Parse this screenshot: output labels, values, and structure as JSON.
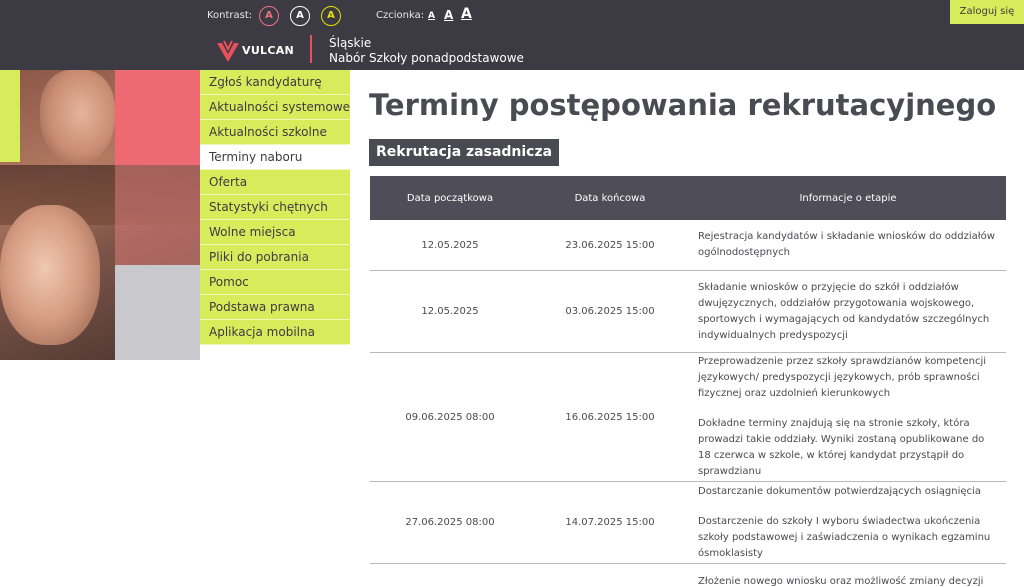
{
  "header": {
    "contrast_label": "Kontrast:",
    "contrast_options": [
      "A",
      "A",
      "A"
    ],
    "font_label": "Czcionka:",
    "font_options": [
      "A",
      "A",
      "A"
    ],
    "login_label": "Zaloguj się",
    "logo_text": "VULCAN",
    "region_line1": "Śląskie",
    "region_line2": "Nabór Szkoły ponadpodstawowe"
  },
  "menu": {
    "items": [
      {
        "label": "Zgłoś kandydaturę"
      },
      {
        "label": "Aktualności systemowe"
      },
      {
        "label": "Aktualności szkolne"
      },
      {
        "label": "Terminy naboru"
      },
      {
        "label": "Oferta"
      },
      {
        "label": "Statystyki chętnych"
      },
      {
        "label": "Wolne miejsca"
      },
      {
        "label": "Pliki do pobrania"
      },
      {
        "label": "Pomoc"
      },
      {
        "label": "Podstawa prawna"
      },
      {
        "label": "Aplikacja mobilna"
      }
    ],
    "active_label": "Terminy naboru"
  },
  "main": {
    "title": "Terminy postępowania rekrutacyjnego",
    "section_title": "Rekrutacja zasadnicza",
    "table": {
      "headers": [
        "Data początkowa",
        "Data końcowa",
        "Informacje o etapie"
      ],
      "rows": [
        {
          "start": "12.05.2025",
          "end": "23.06.2025 15:00",
          "info": [
            "Rejestracja kandydatów i składanie wniosków do oddziałów ogólnodostępnych"
          ]
        },
        {
          "start": "12.05.2025",
          "end": "03.06.2025 15:00",
          "info": [
            "Składanie wniosków o przyjęcie do szkół i oddziałów dwujęzycznych, oddziałów przygotowania wojskowego, sportowych i wymagających od kandydatów szczególnych indywidualnych predyspozycji"
          ]
        },
        {
          "start": "09.06.2025 08:00",
          "end": "16.06.2025 15:00",
          "info": [
            "Przeprowadzenie przez szkoły sprawdzianów kompetencji językowych/ predyspozycji językowych, prób sprawności fizycznej oraz uzdolnień kierunkowych",
            "Dokładne terminy znajdują się na stronie szkoły, która prowadzi takie oddziały. Wyniki zostaną opublikowane do 18 czerwca w szkole, w której kandydat przystąpił do sprawdzianu"
          ]
        },
        {
          "start": "27.06.2025 08:00",
          "end": "14.07.2025 15:00",
          "info": [
            "Dostarczanie dokumentów potwierdzających osiągnięcia",
            "Dostarczenie do szkoły I wyboru świadectwa ukończenia szkoły podstawowej i zaświadczenia o wynikach egzaminu ósmoklasisty"
          ]
        },
        {
          "start": "",
          "end": "",
          "info": [
            "Złożenie nowego wniosku oraz możliwość zmiany decyzji"
          ]
        }
      ]
    }
  },
  "colors": {
    "header_bg": "#3c3b43",
    "accent_green": "#d7ec5a",
    "accent_pink": "#ee6a72",
    "table_header_bg": "#4f4e58"
  }
}
